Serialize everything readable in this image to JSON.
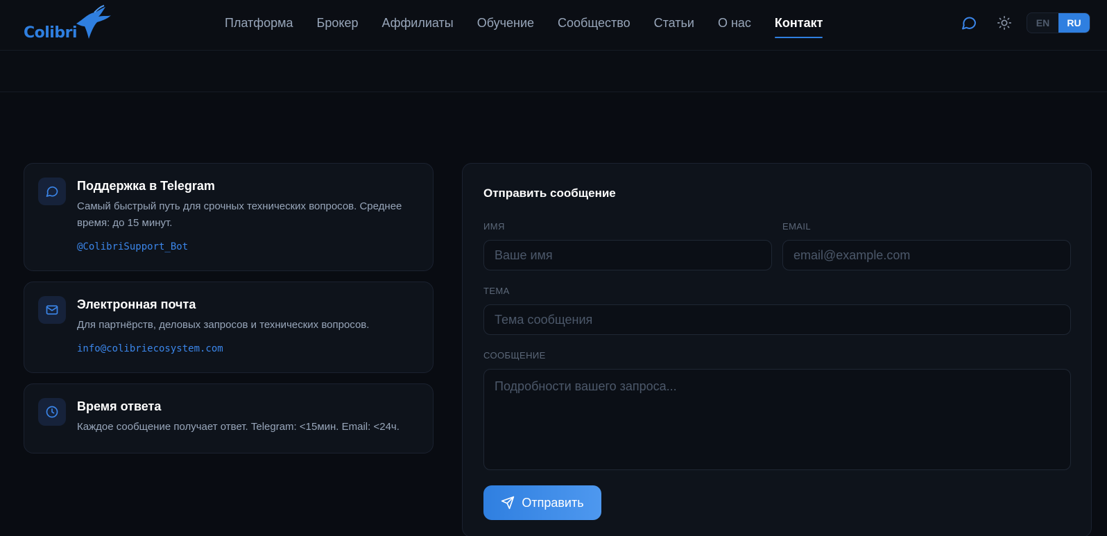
{
  "header": {
    "logo_text": "Colibri",
    "nav": [
      {
        "label": "Платформа"
      },
      {
        "label": "Брокер"
      },
      {
        "label": "Аффилиаты"
      },
      {
        "label": "Обучение"
      },
      {
        "label": "Сообщество"
      },
      {
        "label": "Статьи"
      },
      {
        "label": "О нас"
      },
      {
        "label": "Контакт",
        "active": true
      }
    ],
    "icons": [
      "chat-icon",
      "sun-icon"
    ],
    "languages": [
      {
        "label": "EN"
      },
      {
        "label": "RU",
        "active": true
      }
    ]
  },
  "contact_cards": [
    {
      "icon": "chat-icon",
      "title": "Поддержка в Telegram",
      "description": "Самый быстрый путь для срочных технических вопросов. Среднее время: до 15 минут.",
      "link": "@ColibriSupport_Bot"
    },
    {
      "icon": "mail-icon",
      "title": "Электронная почта",
      "description": "Для партнёрств, деловых запросов и технических вопросов.",
      "link": "info@colibriecosystem.com"
    },
    {
      "icon": "clock-icon",
      "title": "Время ответа",
      "description": "Каждое сообщение получает ответ. Telegram: <15мин. Email: <24ч."
    }
  ],
  "form": {
    "title": "Отправить сообщение",
    "name_label": "Имя",
    "name_placeholder": "Ваше имя",
    "email_label": "Email",
    "email_placeholder": "email@example.com",
    "subject_label": "Тема",
    "subject_placeholder": "Тема сообщения",
    "message_label": "Сообщение",
    "message_placeholder": "Подробности вашего запроса...",
    "submit_label": "Отправить"
  },
  "colors": {
    "accent": "#2f7fe0",
    "background": "#090c12",
    "card": "#0e131b"
  }
}
